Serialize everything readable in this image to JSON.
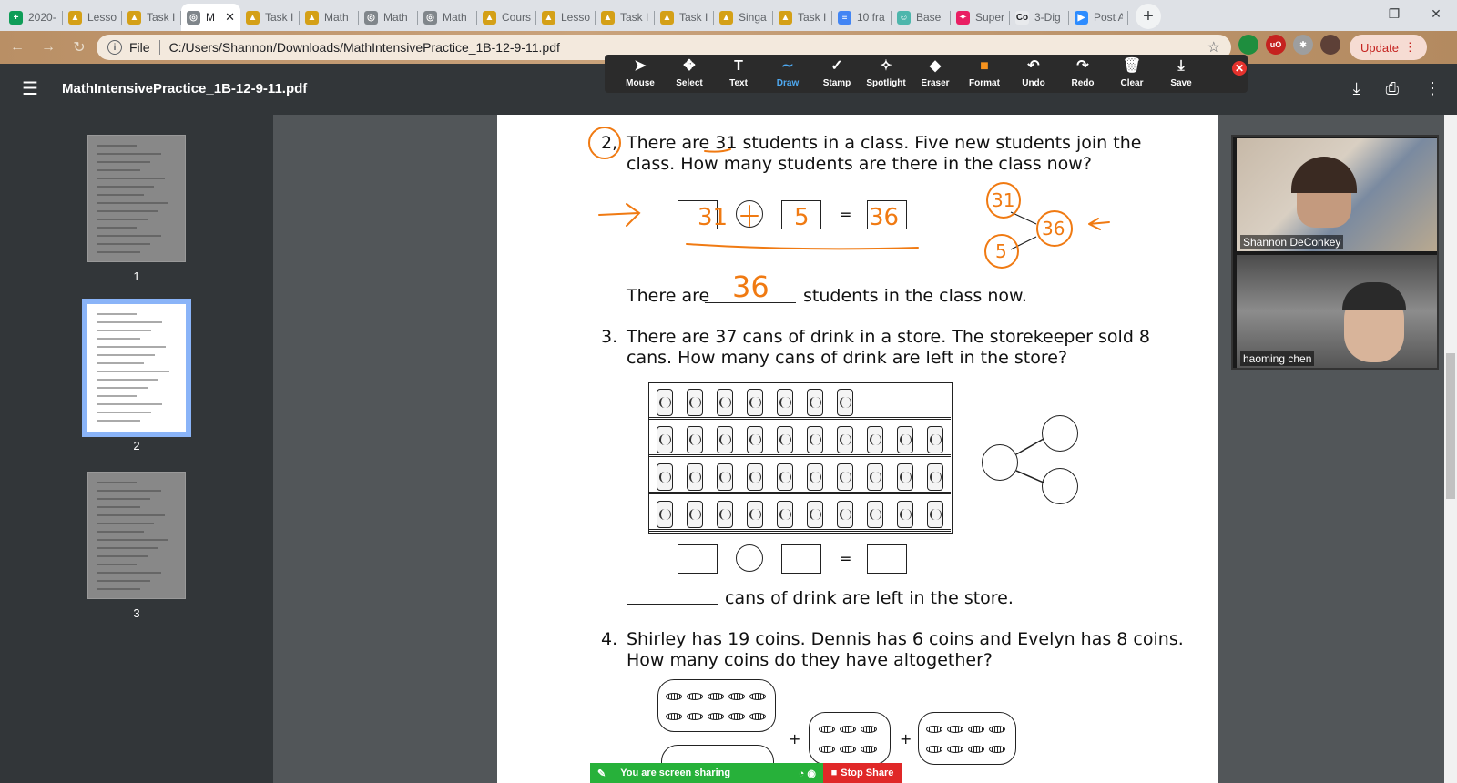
{
  "tabs": [
    {
      "label": "2020-",
      "icon": "sheets-icon",
      "color": "#0f9d58",
      "glyph": "+"
    },
    {
      "label": "Lesso",
      "icon": "classroom-icon",
      "color": "#d4a017",
      "glyph": "▲"
    },
    {
      "label": "Task I",
      "icon": "classroom-icon",
      "color": "#d4a017",
      "glyph": "▲"
    },
    {
      "label": "M",
      "icon": "globe-icon",
      "color": "#80868b",
      "glyph": "◎",
      "active": true
    },
    {
      "label": "Task I",
      "icon": "classroom-icon",
      "color": "#d4a017",
      "glyph": "▲"
    },
    {
      "label": "Math",
      "icon": "classroom-icon",
      "color": "#d4a017",
      "glyph": "▲"
    },
    {
      "label": "Math",
      "icon": "globe-icon",
      "color": "#80868b",
      "glyph": "◎"
    },
    {
      "label": "Math",
      "icon": "globe-icon",
      "color": "#80868b",
      "glyph": "◎"
    },
    {
      "label": "Cours",
      "icon": "classroom-icon",
      "color": "#d4a017",
      "glyph": "▲"
    },
    {
      "label": "Lesso",
      "icon": "classroom-icon",
      "color": "#d4a017",
      "glyph": "▲"
    },
    {
      "label": "Task I",
      "icon": "classroom-icon",
      "color": "#d4a017",
      "glyph": "▲"
    },
    {
      "label": "Task I",
      "icon": "classroom-icon",
      "color": "#d4a017",
      "glyph": "▲"
    },
    {
      "label": "Singa",
      "icon": "classroom-icon",
      "color": "#d4a017",
      "glyph": "▲"
    },
    {
      "label": "Task I",
      "icon": "classroom-icon",
      "color": "#d4a017",
      "glyph": "▲"
    },
    {
      "label": "10 fra",
      "icon": "docs-icon",
      "color": "#4285f4",
      "glyph": "≡"
    },
    {
      "label": "Base",
      "icon": "base-icon",
      "color": "#4db6ac",
      "glyph": "☺"
    },
    {
      "label": "Super",
      "icon": "super-icon",
      "color": "#e91e63",
      "glyph": "✦"
    },
    {
      "label": "3-Dig",
      "icon": "co-icon",
      "color": "#e8eaed",
      "glyph": "Co"
    },
    {
      "label": "Post A",
      "icon": "zoom-icon",
      "color": "#2d8cff",
      "glyph": "▶"
    }
  ],
  "active_tab_close": "✕",
  "new_tab": "+",
  "window_controls": {
    "minimize": "—",
    "restore": "❐",
    "close": "✕"
  },
  "nav": {
    "back": "←",
    "forward": "→",
    "reload": "↻"
  },
  "address": {
    "scheme_label": "File",
    "url": "C:/Users/Shannon/Downloads/MathIntensivePractice_1B-12-9-11.pdf"
  },
  "update_label": "Update",
  "pdf": {
    "title": "MathIntensivePractice_1B-12-9-11.pdf"
  },
  "annot_tools": [
    {
      "label": "Mouse",
      "icon": "cursor-icon",
      "glyph": "➤"
    },
    {
      "label": "Select",
      "icon": "move-icon",
      "glyph": "✥"
    },
    {
      "label": "Text",
      "icon": "text-icon",
      "glyph": "T"
    },
    {
      "label": "Draw",
      "icon": "draw-icon",
      "glyph": "∼",
      "active": true
    },
    {
      "label": "Stamp",
      "icon": "checkmark-icon",
      "glyph": "✓"
    },
    {
      "label": "Spotlight",
      "icon": "spotlight-icon",
      "glyph": "✧"
    },
    {
      "label": "Eraser",
      "icon": "eraser-icon",
      "glyph": "◆"
    },
    {
      "label": "Format",
      "icon": "format-icon",
      "glyph": "■"
    },
    {
      "label": "Undo",
      "icon": "undo-icon",
      "glyph": "↶"
    },
    {
      "label": "Redo",
      "icon": "redo-icon",
      "glyph": "↷"
    },
    {
      "label": "Clear",
      "icon": "trash-icon",
      "glyph": "🗑"
    },
    {
      "label": "Save",
      "icon": "save-icon",
      "glyph": "⤓"
    }
  ],
  "thumbnails": [
    "1",
    "2",
    "3"
  ],
  "worksheet": {
    "q2": {
      "num": "2,",
      "line1": "There are 31 students in a class.  Five new students join the",
      "line2": "class.  How many students are there in the class now?",
      "answer_prefix": "There are",
      "answer_suffix": "students in the class now.",
      "eq_sign": "="
    },
    "q3": {
      "num": "3.",
      "line1": "There are 37 cans of drink in a store.  The storekeeper sold 8",
      "line2": "cans.  How many cans of drink are left in the store?",
      "eq_sign": "=",
      "answer_suffix": "cans of drink are left in the store."
    },
    "q4": {
      "num": "4.",
      "line1": "Shirley has 19 coins.  Dennis has 6 coins and Evelyn has 8 coins.",
      "line2": "How many coins do they have altogether?",
      "plus": "+"
    }
  },
  "handwriting": {
    "box1": "31",
    "box2": "5",
    "box3": "36",
    "blank": "36",
    "bond_top": "31",
    "bond_bottom": "5",
    "bond_whole": "36",
    "color": "#f07a12"
  },
  "participants": [
    {
      "name": "Shannon DeConkey"
    },
    {
      "name": "haoming chen"
    }
  ],
  "screen_share": {
    "status": "You are screen sharing",
    "stop": "Stop Share"
  }
}
